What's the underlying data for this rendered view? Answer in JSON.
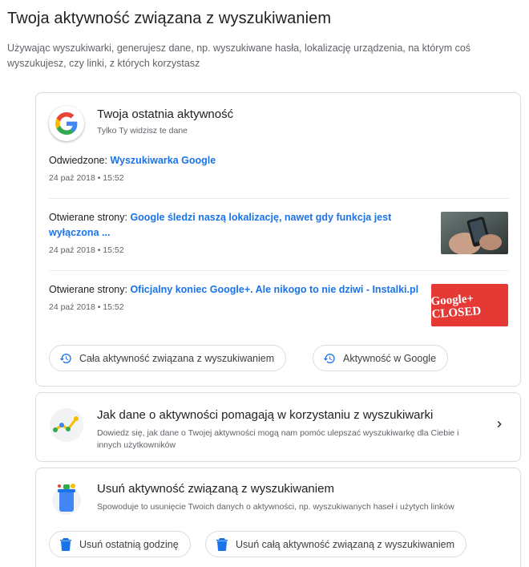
{
  "page": {
    "title": "Twoja aktywność związana z wyszukiwaniem",
    "description": "Używając wyszukiwarki, generujesz dane, np. wyszukiwane hasła, lokalizację urządzenia, na którym coś wyszukujesz, czy linki, z których korzystasz"
  },
  "recent": {
    "heading": "Twoja ostatnia aktywność",
    "subtitle": "Tylko Ty widzisz te dane",
    "entries": [
      {
        "prefix": "Odwiedzone:",
        "link": "Wyszukiwarka Google",
        "date": "24 paź 2018 • 15:52"
      },
      {
        "prefix": "Otwierane strony:",
        "link": "Google śledzi naszą lokalizację, nawet gdy funkcja jest wyłączona ...",
        "date": "24 paź 2018 • 15:52"
      },
      {
        "prefix": "Otwierane strony:",
        "link": "Oficjalny koniec Google+. Ale nikogo to nie dziwi - Instalki.pl",
        "date": "24 paź 2018 • 15:52"
      }
    ],
    "thumb2_text": "Google+ CLOSED",
    "chips": {
      "all_activity": "Cała aktywność związana z wyszukiwaniem",
      "google_activity": "Aktywność w Google"
    }
  },
  "help_card": {
    "heading": "Jak dane o aktywności pomagają w korzystaniu z wyszukiwarki",
    "description": "Dowiedz się, jak dane o Twojej aktywności mogą nam pomóc ulepszać wyszukiwarkę dla Ciebie i innych użytkowników"
  },
  "delete_card": {
    "heading": "Usuń aktywność związaną z wyszukiwaniem",
    "description": "Spowoduje to usunięcie Twoich danych o aktywności, np. wyszukiwanych haseł i użytych linków",
    "buttons": {
      "last_hour": "Usuń ostatnią godzinę",
      "all": "Usuń całą aktywność związaną z wyszukiwaniem"
    }
  },
  "icons": {
    "history": "history-icon",
    "trash": "trash-icon",
    "chevron": "chevron-right-icon",
    "google": "google-logo-icon"
  },
  "colors": {
    "link": "#1a73e8",
    "blue": "#4285f4",
    "red": "#ea4335",
    "yellow": "#fbbc04",
    "green": "#34a853"
  }
}
